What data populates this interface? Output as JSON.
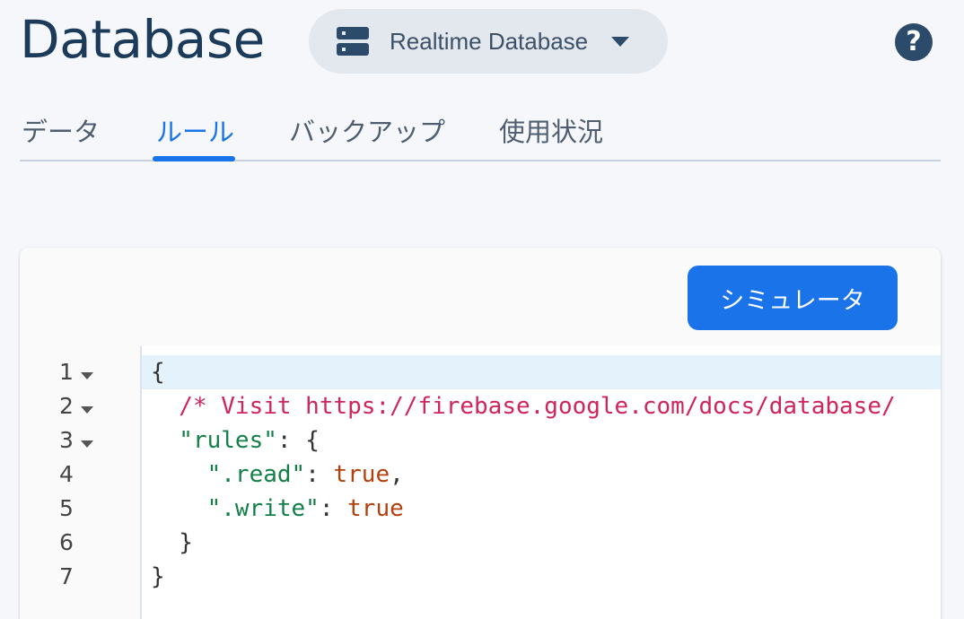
{
  "header": {
    "title": "Database",
    "db_selector": {
      "icon": "database-icon",
      "label": "Realtime Database"
    },
    "help_icon": "help-icon"
  },
  "tabs": [
    {
      "label": "データ",
      "active": false
    },
    {
      "label": "ルール",
      "active": true
    },
    {
      "label": "バックアップ",
      "active": false
    },
    {
      "label": "使用状況",
      "active": false
    }
  ],
  "card": {
    "simulator_label": "シミュレータ"
  },
  "editor": {
    "active_line": 1,
    "line_numbers": [
      "1",
      "2",
      "3",
      "4",
      "5",
      "6",
      "7"
    ],
    "foldable_lines": [
      1,
      2,
      3
    ],
    "lines": [
      {
        "tokens": [
          {
            "t": "{",
            "c": "punct"
          }
        ]
      },
      {
        "tokens": [
          {
            "t": "  /* Visit https://firebase.google.com/docs/database/",
            "c": "comment"
          }
        ]
      },
      {
        "tokens": [
          {
            "t": "  \"rules\"",
            "c": "key"
          },
          {
            "t": ": {",
            "c": "punct"
          }
        ]
      },
      {
        "tokens": [
          {
            "t": "    \".read\"",
            "c": "key"
          },
          {
            "t": ": ",
            "c": "punct"
          },
          {
            "t": "true",
            "c": "bool"
          },
          {
            "t": ",",
            "c": "punct"
          }
        ]
      },
      {
        "tokens": [
          {
            "t": "    \".write\"",
            "c": "key"
          },
          {
            "t": ": ",
            "c": "punct"
          },
          {
            "t": "true",
            "c": "bool"
          }
        ]
      },
      {
        "tokens": [
          {
            "t": "  }",
            "c": "punct"
          }
        ]
      },
      {
        "tokens": [
          {
            "t": "}",
            "c": "punct"
          }
        ]
      }
    ]
  },
  "colors": {
    "accent": "#1a73e8",
    "title": "#1c3a5a",
    "comment": "#d0245a",
    "key": "#148048",
    "bool": "#b5400d"
  }
}
